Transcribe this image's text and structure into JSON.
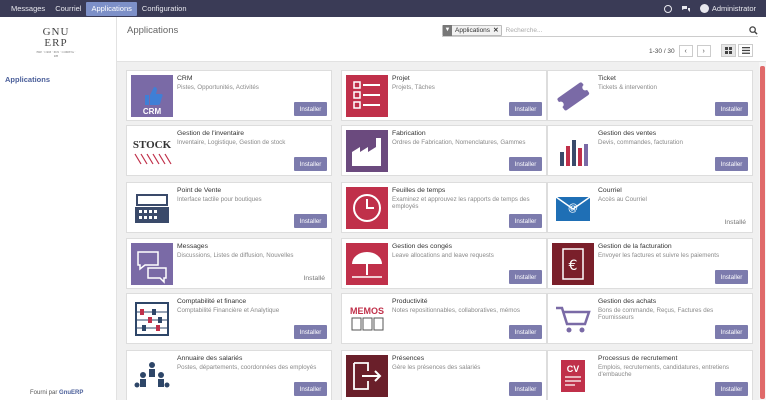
{
  "topbar": {
    "menus": [
      "Messages",
      "Courriel",
      "Applications",
      "Configuration"
    ],
    "active_menu": "Applications",
    "user": "Administrator"
  },
  "sidebar": {
    "logo": {
      "line1": "GNU",
      "line2": "ERP",
      "tagline": "ERP · CRM · POS · COMPTA · RH"
    },
    "item": "Applications",
    "footer_prefix": "Fourni par",
    "footer_brand": "GnuERP"
  },
  "control": {
    "title": "Applications",
    "facet_label": "Applications",
    "search_placeholder": "Recherche...",
    "pager": "1-30 / 30"
  },
  "apps": [
    {
      "name": "CRM",
      "desc": "Pistes, Opportunités, Activités",
      "state": "Installer",
      "icon": "crm-icon",
      "color": "#7a6aa6"
    },
    {
      "name": "Projet",
      "desc": "Projets, Tâches",
      "state": "Installer",
      "icon": "project-checklist-icon",
      "color": "#c0304a"
    },
    {
      "name": "Ticket",
      "desc": "Tickets & intervention",
      "state": "Installer",
      "icon": "ticket-icon",
      "color": "#7a6aa6"
    },
    {
      "name": "Gestion de l'inventaire",
      "desc": "Inventaire, Logistique, Gestion de stock",
      "state": "Installer",
      "icon": "stock-icon",
      "color": "#333333"
    },
    {
      "name": "Fabrication",
      "desc": "Ordres de Fabrication, Nomenclatures, Gammes",
      "state": "Installer",
      "icon": "factory-icon",
      "color": "#6b4a7e"
    },
    {
      "name": "Gestion des ventes",
      "desc": "Devis, commandes, facturation",
      "state": "Installer",
      "icon": "sales-chart-icon",
      "color": "#c0304a"
    },
    {
      "name": "Point de Vente",
      "desc": "Interface tactile pour boutiques",
      "state": "Installer",
      "icon": "cash-register-icon",
      "color": "#3a4a6a"
    },
    {
      "name": "Feuilles de temps",
      "desc": "Examinez et approuvez les rapports de temps des employés",
      "state": "Installer",
      "icon": "clock-icon",
      "color": "#c0304a"
    },
    {
      "name": "Courriel",
      "desc": "Accès au Courriel",
      "state": "Installé",
      "icon": "mail-icon",
      "color": "#1f6fb5"
    },
    {
      "name": "Messages",
      "desc": "Discussions, Listes de diffusion, Nouvelles",
      "state": "Installé",
      "icon": "chat-icon",
      "color": "#7a6aa6"
    },
    {
      "name": "Gestion des congés",
      "desc": "Leave allocations and leave requests",
      "state": "Installer",
      "icon": "umbrella-icon",
      "color": "#c0304a"
    },
    {
      "name": "Gestion de la facturation",
      "desc": "Envoyer les factures et suivre les paiements",
      "state": "Installer",
      "icon": "invoice-euro-icon",
      "color": "#7a1f2a"
    },
    {
      "name": "Comptabilité et finance",
      "desc": "Comptabilité Financière et Analytique",
      "state": "Installer",
      "icon": "abacus-icon",
      "color": "#2e4668"
    },
    {
      "name": "Productivité",
      "desc": "Notes repositionnables, collaboratives, mémos",
      "state": "Installer",
      "icon": "memos-icon",
      "color": "#c0304a"
    },
    {
      "name": "Gestion des achats",
      "desc": "Bons de commande, Reçus, Factures des Fournisseurs",
      "state": "Installer",
      "icon": "cart-icon",
      "color": "#7a6aa6"
    },
    {
      "name": "Annuaire des salariés",
      "desc": "Postes, départements, coordonnées des employés",
      "state": "Installer",
      "icon": "people-icon",
      "color": "#2e4668"
    },
    {
      "name": "Présences",
      "desc": "Gère les présences des salariés",
      "state": "Installer",
      "icon": "attendance-icon",
      "color": "#6a1f2a"
    },
    {
      "name": "Processus de recrutement",
      "desc": "Emplois, recrutements, candidatures, entretiens d'embauche",
      "state": "Installer",
      "icon": "cv-icon",
      "color": "#c0304a"
    }
  ]
}
